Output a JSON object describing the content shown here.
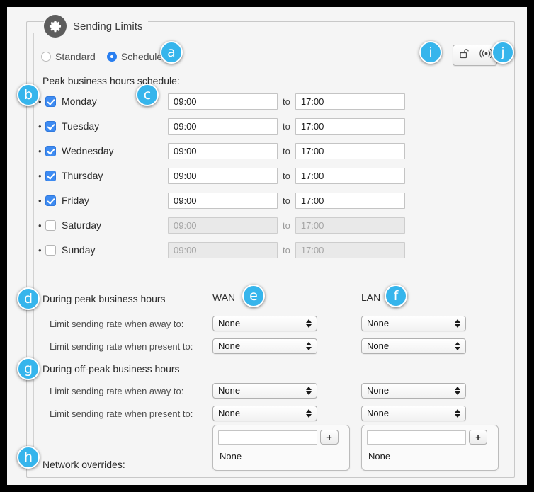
{
  "window": {
    "title": "Sending Limits",
    "gear_icon": "gear-icon"
  },
  "toolbar": {
    "lock_icon": "unlocked-padlock-icon",
    "broadcast_icon": "wireless-broadcast-icon"
  },
  "mode": {
    "standard_label": "Standard",
    "scheduled_label": "Scheduled",
    "selected": "Scheduled"
  },
  "schedule": {
    "heading": "Peak business hours schedule:",
    "to_label": "to",
    "days": [
      {
        "label": "Monday",
        "checked": true,
        "start": "09:00",
        "end": "17:00"
      },
      {
        "label": "Tuesday",
        "checked": true,
        "start": "09:00",
        "end": "17:00"
      },
      {
        "label": "Wednesday",
        "checked": true,
        "start": "09:00",
        "end": "17:00"
      },
      {
        "label": "Thursday",
        "checked": true,
        "start": "09:00",
        "end": "17:00"
      },
      {
        "label": "Friday",
        "checked": true,
        "start": "09:00",
        "end": "17:00"
      },
      {
        "label": "Saturday",
        "checked": false,
        "start": "09:00",
        "end": "17:00"
      },
      {
        "label": "Sunday",
        "checked": false,
        "start": "09:00",
        "end": "17:00"
      }
    ]
  },
  "columns": {
    "wan": "WAN",
    "lan": "LAN"
  },
  "peak": {
    "heading": "During peak business hours",
    "away_label": "Limit sending rate when away to:",
    "present_label": "Limit sending rate when present to:",
    "away_wan": "None",
    "away_lan": "None",
    "present_wan": "None",
    "present_lan": "None"
  },
  "offpeak": {
    "heading": "During off-peak business hours",
    "away_label": "Limit sending rate when away to:",
    "present_label": "Limit sending rate when present to:",
    "away_wan": "None",
    "away_lan": "None",
    "present_wan": "None",
    "present_lan": "None"
  },
  "overrides": {
    "label": "Network overrides:",
    "wan_input": "",
    "wan_placeholder": "",
    "wan_list": "None",
    "lan_input": "",
    "lan_placeholder": "",
    "lan_list": "None",
    "add_label": "+"
  },
  "callouts": {
    "a": "a",
    "b": "b",
    "c": "c",
    "d": "d",
    "e": "e",
    "f": "f",
    "g": "g",
    "h": "h",
    "i": "i",
    "j": "j"
  },
  "colors": {
    "callout": "#36b5ec",
    "accent": "#3d8bf2",
    "background": "#f5f5f5"
  }
}
